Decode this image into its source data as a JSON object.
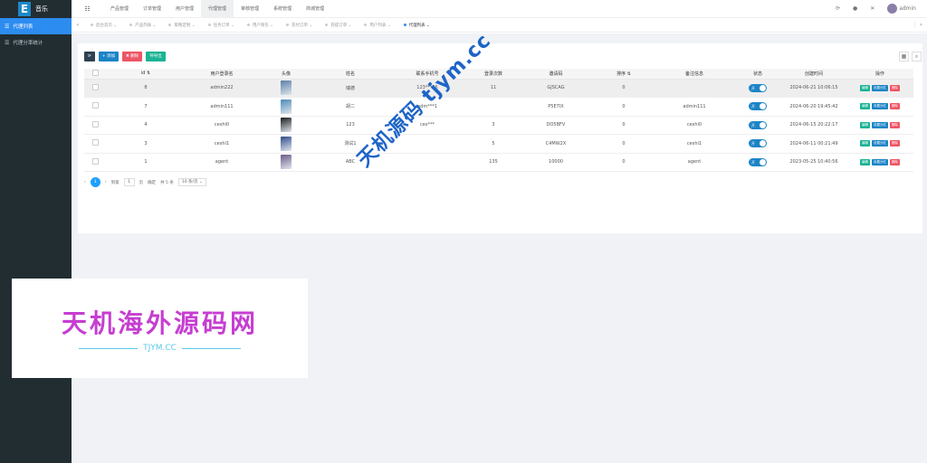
{
  "app": {
    "logo_letter": "E",
    "name": "音乐"
  },
  "sidebar": {
    "items": [
      {
        "label": "代理列表",
        "icon": "list-icon",
        "active": true
      },
      {
        "label": "代理分率统计",
        "icon": "list-icon",
        "active": false
      }
    ]
  },
  "topnav": {
    "items": [
      "产品管理",
      "订单管理",
      "用户管理",
      "代理管理",
      "审核管理",
      "系统管理",
      "商城管理"
    ],
    "active_index": 3
  },
  "header_right": {
    "user": "admin"
  },
  "tabs": [
    "后台首页",
    "产品列表",
    "策略定制",
    "任务订单",
    "用户钱包",
    "充付订单",
    "充提订单",
    "用户列表",
    "代理列表"
  ],
  "toolbar": {
    "add": "+ 添加",
    "delete": "✖ 删除",
    "export": "导导出"
  },
  "table": {
    "headers": [
      "id",
      "用户登录名",
      "头像",
      "姓名",
      "联系手机号",
      "登录次数",
      "邀请码",
      "排序",
      "备注信息",
      "状态",
      "创建时间",
      "操作"
    ],
    "rows": [
      {
        "id": "8",
        "login": "admin222",
        "name": "瑞德",
        "phone": "123***56",
        "logins": "11",
        "code": "GJSCAG",
        "sort": "0",
        "remark": "",
        "status": "开",
        "created": "2024-06-21 10:06:15",
        "thumb": "#5a7fa5",
        "sel": true
      },
      {
        "id": "7",
        "login": "admin111",
        "name": "胡二",
        "phone": "adm***1",
        "logins": "",
        "code": "P5E7IX",
        "sort": "0",
        "remark": "admin111",
        "status": "开",
        "created": "2024-06-20 19:45:42",
        "thumb": "#4b8ab9",
        "sel": false
      },
      {
        "id": "4",
        "login": "ceshi0",
        "name": "123",
        "phone": "ces***",
        "logins": "3",
        "code": "DO5BFV",
        "sort": "0",
        "remark": "ceshi0",
        "status": "开",
        "created": "2024-06-15 20:22:17",
        "thumb": "#1a1a1a",
        "sel": false
      },
      {
        "id": "3",
        "login": "ceshi1",
        "name": "测试1",
        "phone": "",
        "logins": "5",
        "code": "C4MW2X",
        "sort": "0",
        "remark": "ceshi1",
        "status": "开",
        "created": "2024-06-11 00:21:49",
        "thumb": "#2f4a8a",
        "sel": false
      },
      {
        "id": "1",
        "login": "agent",
        "name": "ABC",
        "phone": "",
        "logins": "135",
        "code": "10000",
        "sort": "0",
        "remark": "agent",
        "status": "开",
        "created": "2023-05-25 10:40:56",
        "thumb": "#6a5a8a",
        "sel": false
      }
    ],
    "ops": [
      "编辑",
      "设置分红",
      "删除"
    ]
  },
  "pager": {
    "page": "1",
    "goto": "到第",
    "page_unit": "页",
    "confirm": "确定",
    "total": "共 5 条",
    "per_page": "10 条/页"
  },
  "watermark": {
    "diag": "天机源码 tjym.cc",
    "title": "天机海外源码网",
    "sub": "TJYM.CC"
  },
  "colors": {
    "sidebar": "#222d32",
    "accent": "#2d8cf0",
    "add": "#1c84c6",
    "del": "#ed5565",
    "export": "#1ab394"
  }
}
